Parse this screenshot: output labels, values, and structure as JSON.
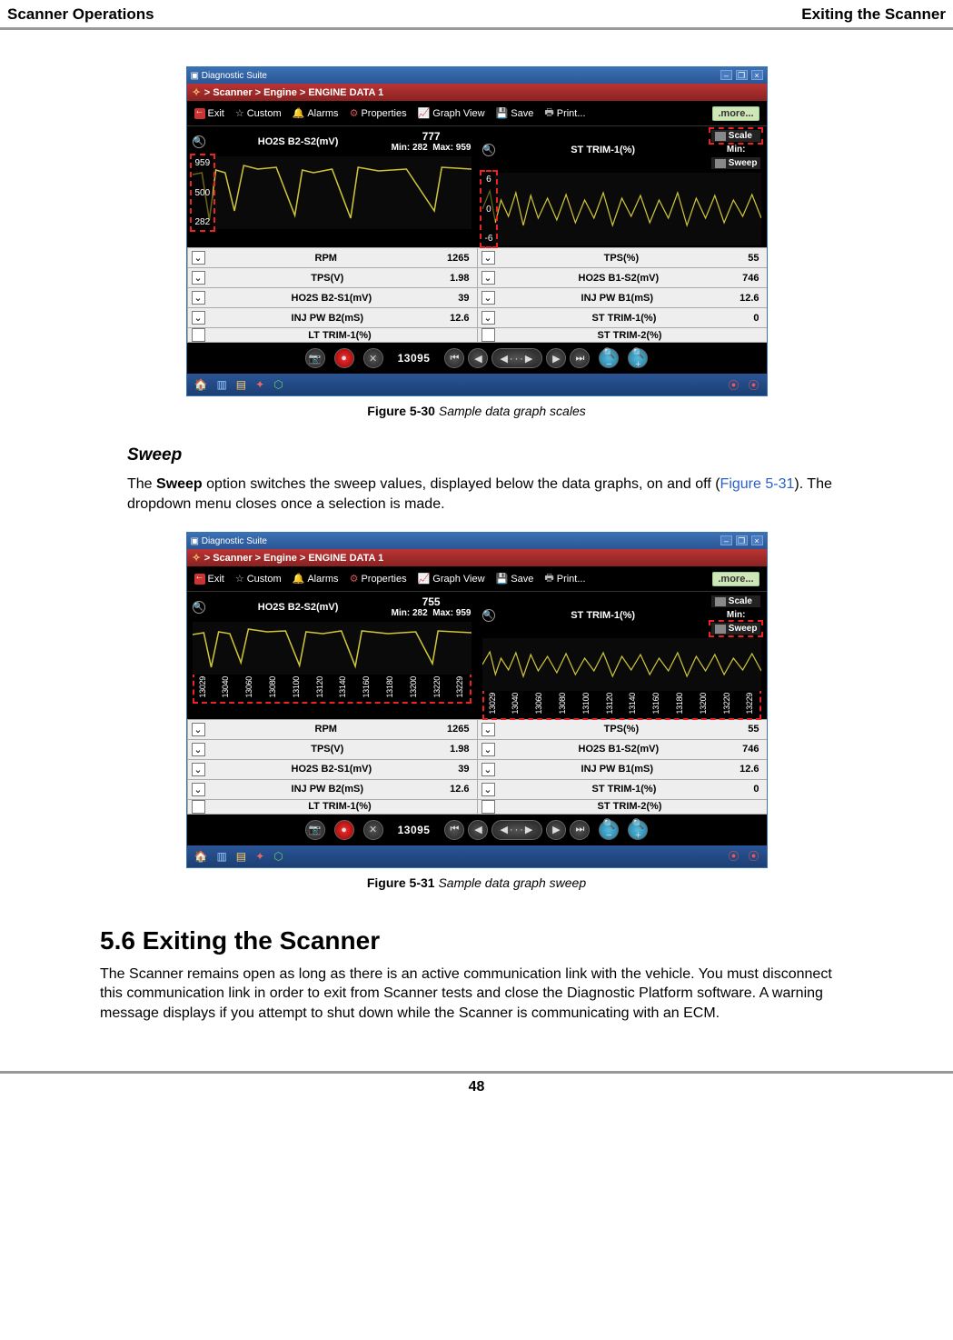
{
  "header": {
    "left": "Scanner Operations",
    "right": "Exiting the Scanner"
  },
  "page_number": "48",
  "sweep_section": {
    "heading": "Sweep",
    "para_pre": "The ",
    "para_bold": "Sweep",
    "para_mid": " option switches the sweep values, displayed below the data graphs, on and off (",
    "para_link": "Figure 5-31",
    "para_post": "). The dropdown menu closes once a selection is made."
  },
  "exit_section": {
    "heading": "5.6   Exiting the Scanner",
    "para": "The Scanner remains open as long as there is an active communication link with the vehicle. You must disconnect this communication link in order to exit from Scanner tests and close the Diagnostic Platform software. A warning message displays if you attempt to shut down while the Scanner is communicating with an ECM."
  },
  "fig30": {
    "label": "Figure 5-30",
    "desc": " Sample data graph scales"
  },
  "fig31": {
    "label": "Figure 5-31",
    "desc": " Sample data graph sweep"
  },
  "diag": {
    "title": "Diagnostic Suite",
    "breadcrumb": "> Scanner  > Engine  > ENGINE DATA 1",
    "toolbar": {
      "exit": "Exit",
      "custom": "Custom",
      "alarms": "Alarms",
      "properties": "Properties",
      "graphview": "Graph View",
      "save": "Save",
      "print": "Print...",
      "more": ".more..."
    },
    "scale_btn": "Scale",
    "sweep_btn": "Sweep",
    "left_graph": {
      "title": "HO2S B2-S2(mV)",
      "cur_30": "777",
      "cur_31": "755",
      "min": "Min: 282",
      "max": "Max: 959",
      "scale": [
        "959",
        "500",
        "282"
      ]
    },
    "right_graph": {
      "title": "ST TRIM-1(%)",
      "min": "Min:",
      "scale": [
        "6",
        "0",
        "-6"
      ]
    },
    "sweep_ticks": [
      "13029",
      "13040",
      "13060",
      "13080",
      "13100",
      "13120",
      "13140",
      "13160",
      "13180",
      "13200",
      "13220",
      "13229"
    ],
    "list": {
      "l0n": "RPM",
      "l0v": "1265",
      "r0n": "TPS(%)",
      "r0v": "55",
      "l1n": "TPS(V)",
      "l1v": "1.98",
      "r1n": "HO2S B1-S2(mV)",
      "r1v": "746",
      "l2n": "HO2S B2-S1(mV)",
      "l2v": "39",
      "r2n": "INJ PW B1(mS)",
      "r2v": "12.6",
      "l3n": "INJ PW B2(mS)",
      "l3v": "12.6",
      "r3n": "ST TRIM-1(%)",
      "r3v": "0",
      "l4n": "LT TRIM-1(%)",
      "r4n": "ST TRIM-2(%)"
    },
    "counter": "13095"
  },
  "chart_data": [
    {
      "type": "line",
      "title": "HO2S B2-S2(mV)",
      "ylim": [
        282,
        959
      ],
      "ylabel": "mV",
      "min_label": 282,
      "max_label": 959,
      "current": 777,
      "series": [
        {
          "name": "HO2S B2-S2(mV)",
          "approx": true
        }
      ]
    },
    {
      "type": "line",
      "title": "ST TRIM-1(%)",
      "ylim": [
        -6,
        6
      ],
      "ylabel": "%",
      "series": [
        {
          "name": "ST TRIM-1(%)",
          "approx": true
        }
      ]
    },
    {
      "type": "table",
      "title": "Live PID list",
      "rows": [
        {
          "name": "RPM",
          "value": 1265
        },
        {
          "name": "TPS(%)",
          "value": 55
        },
        {
          "name": "TPS(V)",
          "value": 1.98
        },
        {
          "name": "HO2S B1-S2(mV)",
          "value": 746
        },
        {
          "name": "HO2S B2-S1(mV)",
          "value": 39
        },
        {
          "name": "INJ PW B1(mS)",
          "value": 12.6
        },
        {
          "name": "INJ PW B2(mS)",
          "value": 12.6
        },
        {
          "name": "ST TRIM-1(%)",
          "value": 0
        }
      ]
    }
  ]
}
